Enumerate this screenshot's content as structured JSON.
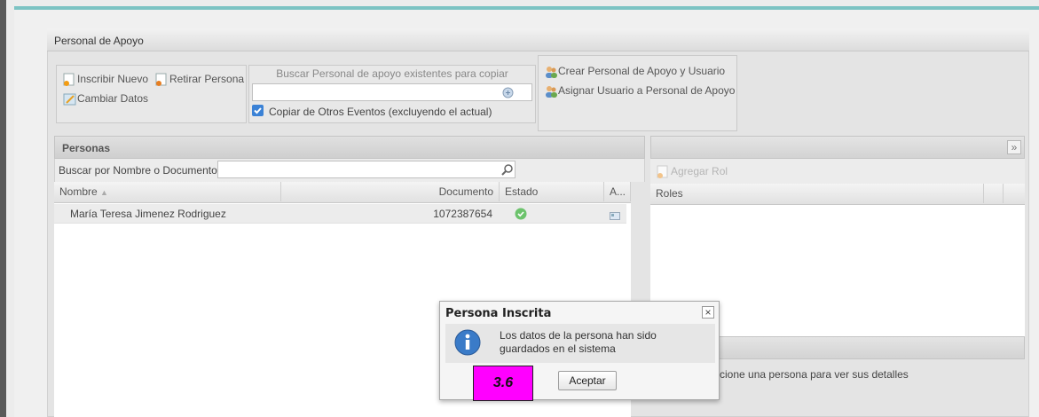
{
  "panel": {
    "title": "Personal de Apoyo"
  },
  "actions": {
    "inscribir": "Inscribir Nuevo",
    "retirar": "Retirar Persona",
    "cambiar": "Cambiar Datos"
  },
  "search_copy": {
    "title": "Buscar Personal de apoyo existentes para copiar",
    "value": "",
    "checkbox_label": "Copiar de Otros Eventos (excluyendo el actual)",
    "checked": true
  },
  "user_actions": {
    "crear": "Crear Personal de Apoyo y Usuario",
    "asignar": "Asignar Usuario a Personal de Apoyo"
  },
  "personas": {
    "title": "Personas",
    "search_label": "Buscar por Nombre o Documento:",
    "search_value": "",
    "columns": [
      "Nombre",
      "Documento",
      "Estado",
      "A..."
    ],
    "rows": [
      {
        "nombre": "María Teresa Jimenez Rodriguez",
        "documento": "1072387654"
      }
    ]
  },
  "right_panel": {
    "expand": "»",
    "agregar_rol": "Agregar Rol",
    "roles_header": "Roles",
    "details_hint": "ccione una persona para ver sus detalles"
  },
  "dialog": {
    "title": "Persona Inscrita",
    "message_line1": "Los datos de la persona han sido",
    "message_line2": "guardados en el sistema",
    "ok_label": "Aceptar",
    "close": "×"
  },
  "badge": {
    "label": "3.6",
    "color": "#ff00ff"
  },
  "colors": {
    "accent_line": "#7cc3c3",
    "ok_green": "#6cc36c",
    "info_blue": "#3a7bc8"
  }
}
